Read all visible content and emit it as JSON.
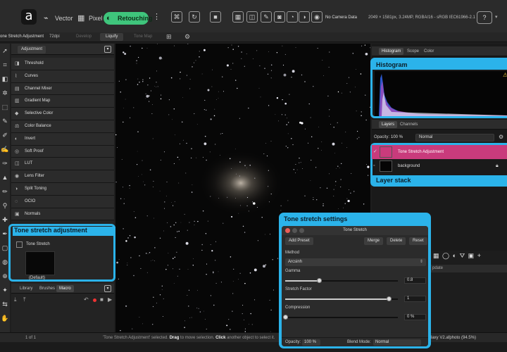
{
  "topbar": {
    "personas": [
      "Vector",
      "Pixel",
      "Retouching"
    ],
    "camera_data": "No Camera Data",
    "doc_info": "2049 × 1581px, 3.24MP, RGBA/16 - sRGB IEC61966-2.1"
  },
  "context_bar": {
    "title": "one Stretch Adjustment",
    "dpi": "72dpi",
    "tabs": [
      "Develop",
      "Liquify",
      "Tone Map"
    ],
    "active_tab": "Liquify"
  },
  "left_panel": {
    "tab": "Adjustment",
    "items": [
      "Threshold",
      "Curves",
      "Channel Mixer",
      "Gradient Map",
      "Selective Color",
      "Color Balance",
      "Invert",
      "Soft Proof",
      "LUT",
      "Lens Filter",
      "Split Toning",
      "OCIO",
      "Normals"
    ],
    "bottom_tabs": [
      "Library",
      "Brushes",
      "Macro"
    ],
    "active_bottom_tab": "Macro"
  },
  "preset_panel": {
    "callout": "Tone stretch adjustment",
    "name": "Tone Stretch",
    "default_label": "(Default)"
  },
  "right_panel": {
    "top_tabs": [
      "Histogram",
      "Scope",
      "Color"
    ],
    "active_top_tab": "Histogram",
    "histogram_callout": "Histogram",
    "layer_tabs": [
      "Layers",
      "Channels"
    ],
    "opacity_label": "Opacity:",
    "opacity_value": "100 %",
    "blend_mode": "Normal",
    "layers": [
      {
        "name": "Tone Stretch Adjustment",
        "selected": true
      },
      {
        "name": "background",
        "selected": false
      }
    ],
    "layer_stack_callout": "Layer stack",
    "updates_label": "pdate"
  },
  "dialog": {
    "callout": "Tone stretch settings",
    "title": "Tone Stretch",
    "buttons": {
      "add_preset": "Add Preset",
      "merge": "Merge",
      "delete": "Delete",
      "reset": "Reset"
    },
    "method_label": "Method",
    "method_value": "Arcsinh",
    "gamma_label": "Gamma",
    "gamma_value": "0.8",
    "gamma_fraction": 0.3,
    "stretch_label": "Stretch Factor",
    "stretch_value": "1",
    "stretch_fraction": 0.92,
    "compression_label": "Compression",
    "compression_value": "0 %",
    "compression_fraction": 0.0,
    "opacity_label": "Opacity:",
    "opacity_value": "100 %",
    "blend_label": "Blend Mode:",
    "blend_value": "Normal"
  },
  "status": {
    "pages": "1 of 1",
    "hint_prefix": "'Tone Stretch Adjustment' selected.",
    "hint_drag": "Drag",
    "hint_mid": "to move selection.",
    "hint_click": "Click",
    "hint_end": "another object to select it.",
    "file": "laxy V2.afphoto (94.5%)"
  },
  "colors": {
    "accent_callout": "#2bb3ea",
    "retouch_persona": "#3fc57c",
    "selected_layer": "#c93b7c"
  }
}
